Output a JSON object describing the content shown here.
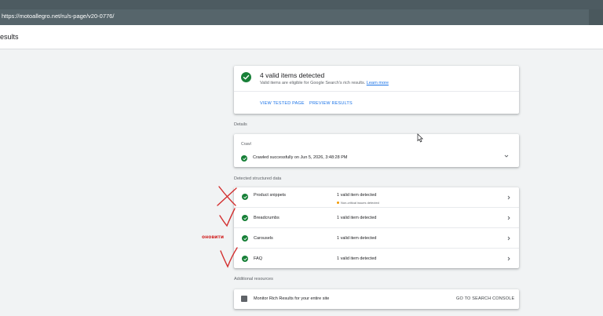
{
  "browser": {
    "url": "https://motoallegro.net/ru/s-page/v20-0776/"
  },
  "header": {
    "title": "esults"
  },
  "summary": {
    "heading": "4 valid items detected",
    "subtext": "Valid items are eligible for Google Search's rich results.",
    "learn_more": "Learn more",
    "view_tested_page": "VIEW TESTED PAGE",
    "preview_results": "PREVIEW RESULTS"
  },
  "details": {
    "label": "Details",
    "crawl_label": "Crawl",
    "crawl_text": "Crawled successfully on Jun 5, 2026, 3:48:28 PM"
  },
  "structured_data": {
    "label": "Detected structured data",
    "items": [
      {
        "name": "Product snippets",
        "count": "1 valid item detected",
        "warning": "Non-critical issues detected"
      },
      {
        "name": "Breadcrumbs",
        "count": "1 valid item detected"
      },
      {
        "name": "Carousels",
        "count": "1 valid item detected"
      },
      {
        "name": "FAQ",
        "count": "1 valid item detected"
      }
    ]
  },
  "additional": {
    "label": "Additional resources",
    "monitor_text": "Monitor Rich Results for your entire site",
    "console_link": "GO TO SEARCH CONSOLE"
  },
  "annotations": {
    "handwritten_label": "оновити"
  },
  "colors": {
    "success": "#188038",
    "link": "#1a73e8",
    "warning": "#f29900",
    "annotation": "#d32f2f"
  }
}
